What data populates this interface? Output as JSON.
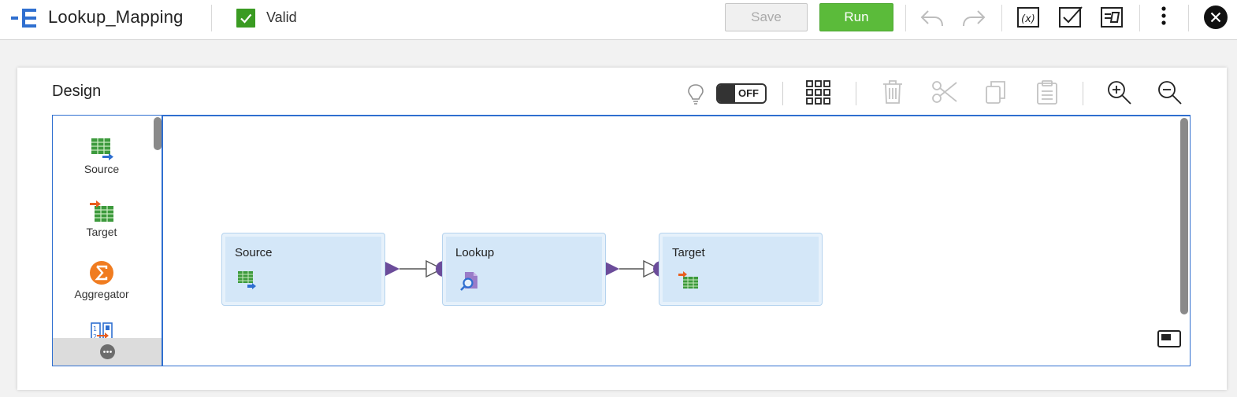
{
  "header": {
    "mapping_name": "Lookup_Mapping",
    "status_label": "Valid",
    "save_label": "Save",
    "run_label": "Run"
  },
  "icons": {
    "app": "mapping-icon",
    "valid": "check-icon",
    "undo": "undo-icon",
    "redo": "redo-icon",
    "expression": "parameter-icon",
    "validate": "validate-icon",
    "properties": "properties-icon",
    "menu": "more-vertical-icon",
    "close": "close-icon"
  },
  "design": {
    "title": "Design",
    "toggle_label": "OFF",
    "tools": [
      "lightbulb-icon",
      "arrange-grid-icon",
      "delete-icon",
      "cut-icon",
      "copy-icon",
      "paste-icon",
      "zoom-in-icon",
      "zoom-out-icon"
    ]
  },
  "palette": {
    "items": [
      {
        "label": "Source",
        "icon": "source-icon"
      },
      {
        "label": "Target",
        "icon": "target-icon"
      },
      {
        "label": "Aggregator",
        "icon": "aggregator-icon"
      },
      {
        "label": "",
        "icon": "sequence-icon"
      }
    ]
  },
  "canvas": {
    "nodes": [
      {
        "label": "Source",
        "icon": "source-icon"
      },
      {
        "label": "Lookup",
        "icon": "lookup-icon"
      },
      {
        "label": "Target",
        "icon": "target-icon"
      }
    ]
  },
  "colors": {
    "run_green": "#5bbb3a",
    "valid_green": "#3a9b22",
    "node_fill": "#d4e7f8",
    "link_purple": "#6b4c9a",
    "accent_blue": "#2f6fd0"
  }
}
